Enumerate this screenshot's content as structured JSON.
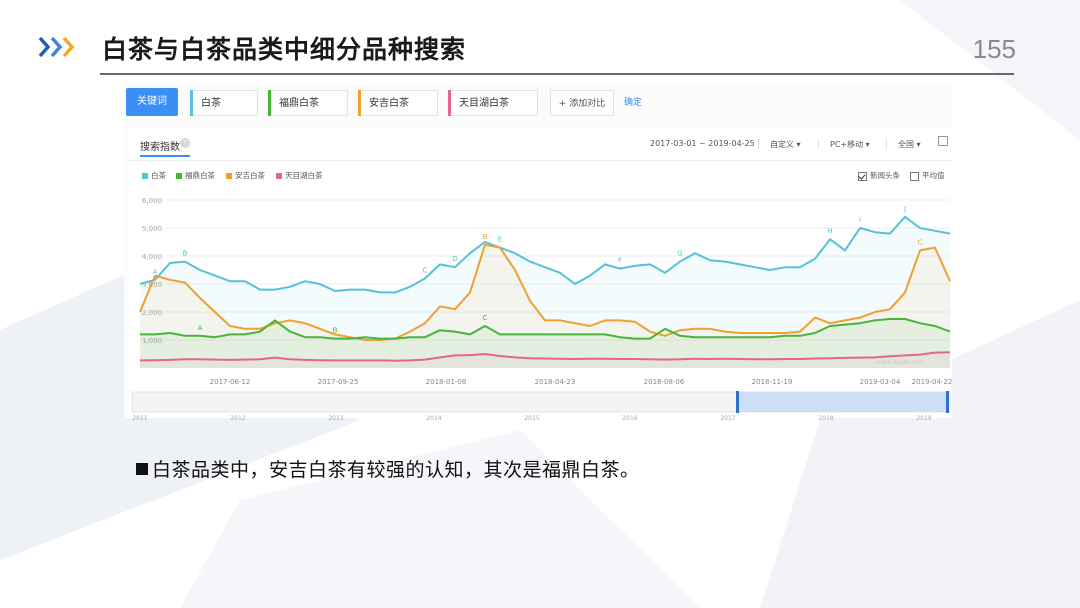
{
  "slide": {
    "title": "白茶与白茶品类中细分品种搜索",
    "page_number": "155",
    "caption": "白茶品类中，安吉白茶有较强的认知，其次是福鼎白茶。",
    "caption_marker_icon": "square-bullet-icon",
    "accent_colors": [
      "#1f5fa8",
      "#f5a623"
    ]
  },
  "keyword_bar": {
    "button_label": "关键词",
    "chips": [
      {
        "label": "白茶",
        "color": "#56c1d8"
      },
      {
        "label": "福鼎白茶",
        "color": "#49b33a"
      },
      {
        "label": "安吉白茶",
        "color": "#f0a030"
      },
      {
        "label": "天目湖白茶",
        "color": "#e2668f"
      }
    ],
    "add_label": "+ 添加对比",
    "confirm_label": "确定"
  },
  "panel": {
    "title": "搜索指数",
    "help_icon": "?",
    "date_range": "2017-03-01 ~ 2019-04-25",
    "custom": "自定义",
    "device": "PC+移动",
    "region": "全国",
    "caret": "▾",
    "export_icon": "export-icon",
    "options": [
      {
        "label": "新闻头条",
        "checked": true
      },
      {
        "label": "平均值",
        "checked": false
      }
    ],
    "watermark": "index.baidu.com"
  },
  "chart_data": {
    "type": "line",
    "x_ticks": [
      "2017-06-12",
      "2017-09-25",
      "2018-01-08",
      "2018-04-23",
      "2018-08-06",
      "2018-11-19",
      "2019-03-04",
      "2019-04-22"
    ],
    "y_ticks": [
      "6,000",
      "5,000",
      "4,000",
      "3,000",
      "2,000",
      "1,000"
    ],
    "ylim": [
      0,
      6000
    ],
    "overview_ticks": [
      "2011",
      "2012",
      "2013",
      "2014",
      "2015",
      "2016",
      "2017",
      "2018",
      "2019"
    ],
    "series": [
      {
        "name": "白茶",
        "color": "#56c1d8",
        "values": [
          3000,
          3150,
          3750,
          3800,
          3500,
          3300,
          3100,
          3100,
          2800,
          2800,
          2900,
          3100,
          3000,
          2750,
          2800,
          2800,
          2700,
          2700,
          2900,
          3200,
          3700,
          3600,
          4100,
          4500,
          4300,
          4100,
          3800,
          3600,
          3400,
          3000,
          3300,
          3700,
          3550,
          3650,
          3700,
          3400,
          3800,
          4100,
          3850,
          3800,
          3700,
          3600,
          3500,
          3600,
          3600,
          3900,
          4600,
          4200,
          5000,
          4850,
          4800,
          5400,
          5000,
          4900,
          4800
        ]
      },
      {
        "name": "福鼎白茶",
        "color": "#49b33a",
        "values": [
          1200,
          1200,
          1250,
          1150,
          1150,
          1100,
          1200,
          1200,
          1300,
          1700,
          1300,
          1100,
          1100,
          1050,
          1050,
          1100,
          1050,
          1050,
          1100,
          1100,
          1350,
          1300,
          1200,
          1500,
          1200,
          1200,
          1200,
          1200,
          1200,
          1200,
          1200,
          1200,
          1100,
          1050,
          1050,
          1400,
          1150,
          1100,
          1100,
          1100,
          1100,
          1100,
          1100,
          1150,
          1150,
          1250,
          1500,
          1550,
          1600,
          1700,
          1750,
          1750,
          1600,
          1500,
          1300
        ]
      },
      {
        "name": "安吉白茶",
        "color": "#f0a030",
        "values": [
          2000,
          3300,
          3150,
          3050,
          2500,
          2000,
          1500,
          1400,
          1400,
          1600,
          1700,
          1600,
          1400,
          1200,
          1100,
          1000,
          1000,
          1050,
          1300,
          1600,
          2200,
          2100,
          2700,
          4400,
          4300,
          3500,
          2400,
          1700,
          1700,
          1600,
          1500,
          1700,
          1700,
          1650,
          1300,
          1150,
          1350,
          1400,
          1400,
          1300,
          1250,
          1250,
          1250,
          1250,
          1300,
          1800,
          1600,
          1700,
          1800,
          2000,
          2100,
          2700,
          4200,
          4300,
          3100
        ]
      },
      {
        "name": "天目湖白茶",
        "color": "#e2668f",
        "values": [
          270,
          280,
          290,
          310,
          310,
          300,
          290,
          300,
          310,
          370,
          310,
          290,
          280,
          270,
          270,
          270,
          270,
          260,
          270,
          300,
          380,
          450,
          460,
          500,
          430,
          380,
          350,
          340,
          330,
          320,
          330,
          330,
          320,
          320,
          310,
          300,
          310,
          330,
          320,
          330,
          320,
          310,
          310,
          320,
          320,
          340,
          350,
          360,
          370,
          380,
          420,
          450,
          480,
          550,
          560
        ]
      }
    ],
    "annotations": [
      {
        "label": "A",
        "series": 0,
        "i": 1
      },
      {
        "label": "B",
        "series": 0,
        "i": 3
      },
      {
        "label": "C",
        "series": 0,
        "i": 19
      },
      {
        "label": "D",
        "series": 0,
        "i": 21
      },
      {
        "label": "E",
        "series": 0,
        "i": 24
      },
      {
        "label": "F",
        "series": 0,
        "i": 32
      },
      {
        "label": "G",
        "series": 0,
        "i": 36
      },
      {
        "label": "H",
        "series": 0,
        "i": 46
      },
      {
        "label": "I",
        "series": 0,
        "i": 48
      },
      {
        "label": "J",
        "series": 0,
        "i": 51
      },
      {
        "label": "A",
        "series": 1,
        "i": 4
      },
      {
        "label": "B",
        "series": 1,
        "i": 13
      },
      {
        "label": "C",
        "series": 1,
        "i": 23
      },
      {
        "label": "B",
        "series": 2,
        "i": 23
      },
      {
        "label": "C",
        "series": 2,
        "i": 52
      }
    ],
    "grid": true,
    "legend_position": "top-left"
  }
}
